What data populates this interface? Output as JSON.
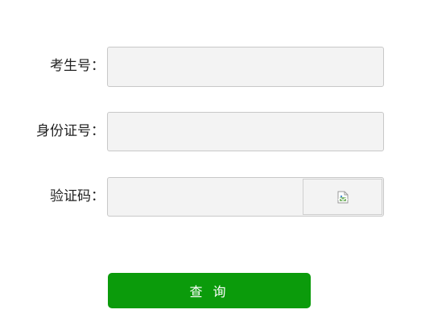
{
  "form": {
    "exam_number_label": "考生号：",
    "exam_number_value": "",
    "id_number_label": "身份证号：",
    "id_number_value": "",
    "captcha_label": "验证码：",
    "captcha_value": "",
    "captcha_image_icon": "broken-image-icon",
    "submit_label": "查 询"
  },
  "colors": {
    "field_background": "#f3f3f3",
    "field_border": "#c8c8c8",
    "submit_background": "#0b9b0b",
    "submit_text": "#ffffff"
  }
}
